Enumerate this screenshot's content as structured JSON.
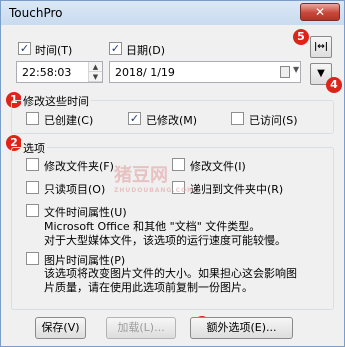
{
  "window": {
    "title": "TouchPro",
    "close_label": "✕"
  },
  "datetime": {
    "time_label": "时间(T)",
    "date_label": "日期(D)",
    "time_value": "22:58:03",
    "date_value": "2018/  1/19",
    "time_checked": true,
    "date_checked": true
  },
  "badges": [
    "1",
    "2",
    "3",
    "4",
    "5"
  ],
  "modify_group": {
    "title": "修改这些时间",
    "items": [
      {
        "label": "已创建(C)",
        "checked": false
      },
      {
        "label": "已修改(M)",
        "checked": true
      },
      {
        "label": "已访问(S)",
        "checked": false
      }
    ]
  },
  "options_group": {
    "title": "选项",
    "items": [
      {
        "label": "修改文件夹(F)",
        "checked": false
      },
      {
        "label": "修改文件(I)",
        "checked": false
      },
      {
        "label": "只读项目(O)",
        "checked": false
      },
      {
        "label": "递归到文件夹中(R)",
        "checked": false
      },
      {
        "label": "文件时间属性(U)",
        "checked": false
      },
      {
        "label": "图片时间属性(P)",
        "checked": false
      }
    ],
    "file_desc": [
      "Microsoft Office 和其他 \"文档\" 文件类型。",
      "对于大型媒体文件，该选项的运行速度可能较慢。"
    ],
    "image_desc": [
      "该选项将改变图片文件的大小。如果担心这会影响图",
      "片质量，请在使用此选项前复制一份图片。"
    ]
  },
  "buttons": {
    "save": "保存(V)",
    "load": "加载(L)...",
    "extra": "额外选项(E)..."
  },
  "watermark": {
    "line1": "猪豆网",
    "line2": "ZHUDOUBANG.COM"
  },
  "colors": {
    "badge": "#e02319",
    "titlebar": "#c9dbef",
    "close": "#c7473a"
  }
}
